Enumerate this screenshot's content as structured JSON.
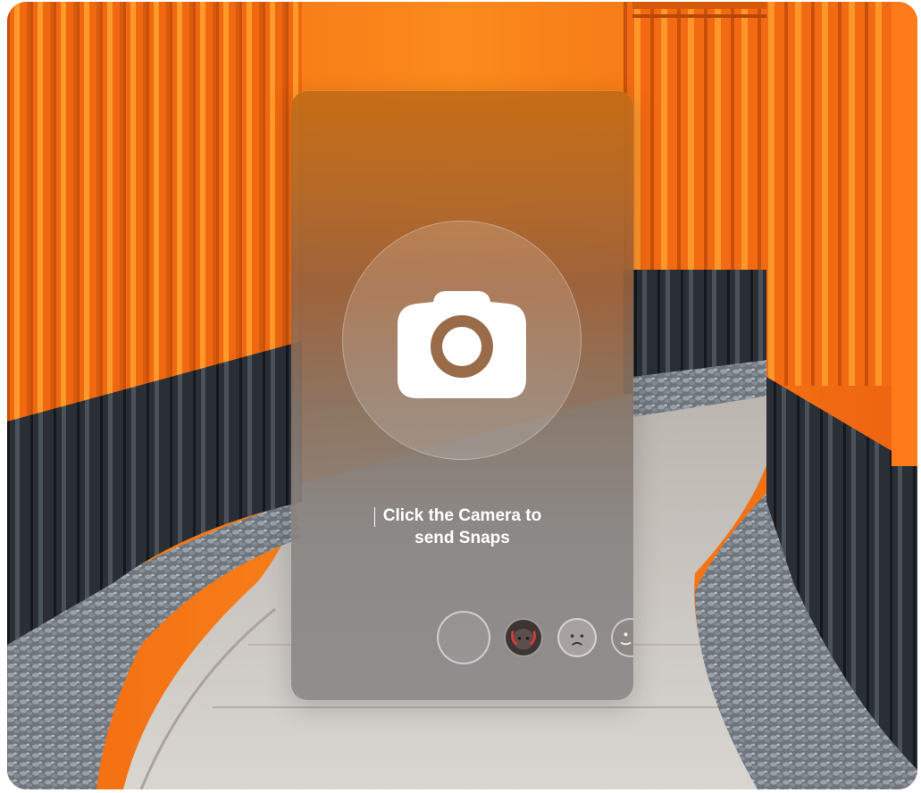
{
  "prompt": {
    "line1": "Click the Camera to",
    "line2": "send Snaps"
  },
  "icons": {
    "camera": "camera-icon",
    "lens_devil": "devil-face-icon",
    "lens_sad": "sad-face-icon",
    "lens_partial": "face-icon"
  },
  "colors": {
    "torii_orange": "#f26a12",
    "card_top": "#c46c16",
    "card_bottom": "#8c8a8a"
  }
}
